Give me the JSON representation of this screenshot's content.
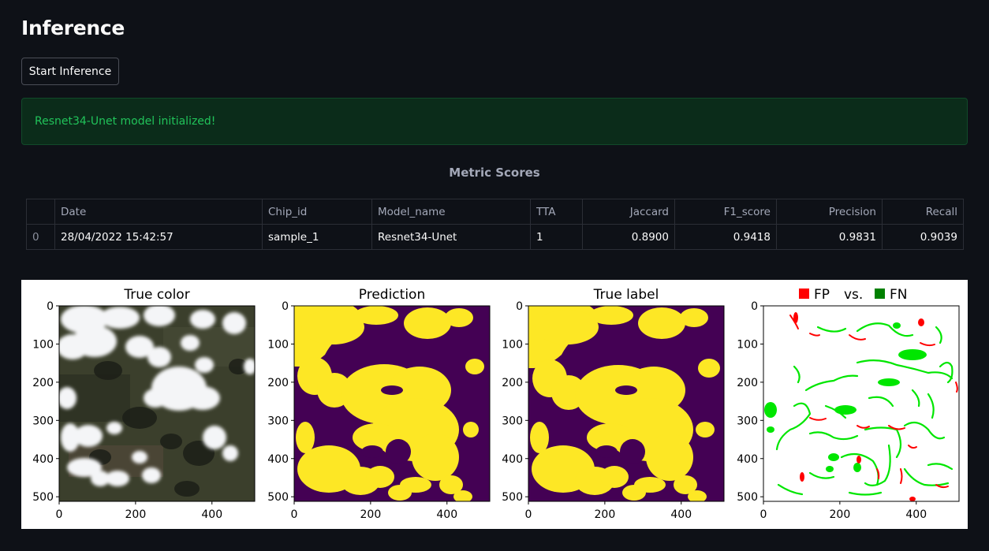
{
  "page": {
    "title": "Inference"
  },
  "controls": {
    "start_button_label": "Start Inference"
  },
  "alert": {
    "message": "Resnet34-Unet model initialized!",
    "color": "#21c35a"
  },
  "metrics": {
    "title": "Metric Scores",
    "columns": [
      "",
      "Date",
      "Chip_id",
      "Model_name",
      "TTA",
      "Jaccard",
      "F1_score",
      "Precision",
      "Recall"
    ],
    "rows": [
      {
        "index": "0",
        "date": "28/04/2022 15:42:57",
        "chip_id": "sample_1",
        "model_name": "Resnet34-Unet",
        "tta": "1",
        "jaccard": "0.8900",
        "f1_score": "0.9418",
        "precision": "0.9831",
        "recall": "0.9039"
      }
    ]
  },
  "figure": {
    "panels": [
      {
        "title": "True color"
      },
      {
        "title": "Prediction"
      },
      {
        "title": "True label"
      },
      {
        "title": "FP   vs.   FN"
      }
    ],
    "legend": {
      "fp_label": "FP",
      "vs_label": "vs.",
      "fn_label": "FN",
      "fp_color": "#ff0000",
      "fn_color": "#008000"
    },
    "y_ticks": [
      "0",
      "100",
      "200",
      "300",
      "400",
      "500"
    ],
    "x_ticks": [
      "0",
      "200",
      "400"
    ],
    "colors": {
      "cloud": "#fde725",
      "background": "#440154",
      "fn_green": "#00e600",
      "fp_red": "#ff0000"
    }
  }
}
